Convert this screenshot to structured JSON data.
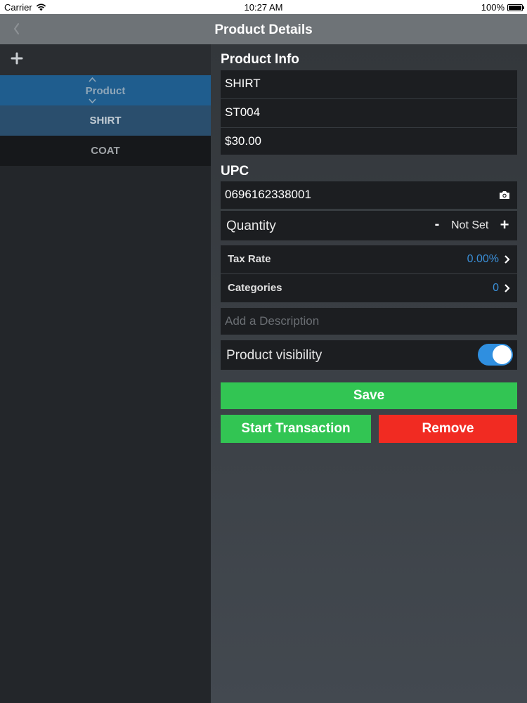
{
  "status_bar": {
    "carrier": "Carrier",
    "time": "10:27 AM",
    "battery": "100%",
    "battery_level": 1.0
  },
  "nav": {
    "title": "Product Details",
    "back_icon": "chevron-left-icon"
  },
  "sidebar": {
    "add_icon": "plus-icon",
    "header_label": "Product",
    "items": [
      {
        "label": "SHIRT",
        "selected": true
      },
      {
        "label": "COAT",
        "selected": false
      }
    ]
  },
  "product_info": {
    "title": "Product Info",
    "name": "SHIRT",
    "sku": "ST004",
    "price": "$30.00"
  },
  "upc": {
    "title": "UPC",
    "value": "0696162338001",
    "icon": "camera-icon"
  },
  "quantity": {
    "label": "Quantity",
    "minus": "-",
    "value": "Not Set",
    "plus": "+"
  },
  "tax_rate": {
    "label": "Tax Rate",
    "value": "0.00%"
  },
  "categories": {
    "label": "Categories",
    "value": "0"
  },
  "description": {
    "placeholder": "Add a Description",
    "value": ""
  },
  "visibility": {
    "label": "Product visibility",
    "enabled": true
  },
  "buttons": {
    "save": "Save",
    "start_transaction": "Start Transaction",
    "remove": "Remove"
  },
  "colors": {
    "accent_blue": "#2f8fe0",
    "value_blue": "#3a8fd8",
    "green": "#32c553",
    "red": "#f12b22",
    "selected_row": "#2a4e6d",
    "header_blue": "#1f5d8e"
  }
}
